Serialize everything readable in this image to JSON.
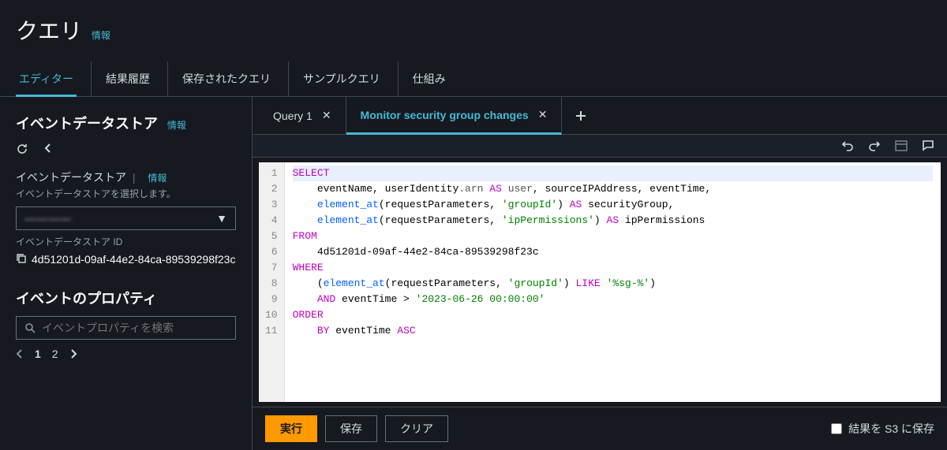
{
  "header": {
    "title": "クエリ",
    "info": "情報"
  },
  "tabs": [
    "エディター",
    "結果履歴",
    "保存されたクエリ",
    "サンプルクエリ",
    "仕組み"
  ],
  "active_tab": 0,
  "sidebar": {
    "datastore": {
      "title": "イベントデータストア",
      "info": "情報",
      "label": "イベントデータストア",
      "label_info": "情報",
      "hint": "イベントデータストアを選択します。",
      "selected": "————",
      "id_label": "イベントデータストア ID",
      "id_value": "4d51201d-09af-44e2-84ca-89539298f23c"
    },
    "properties": {
      "title": "イベントのプロパティ",
      "search_placeholder": "イベントプロパティを検索",
      "pages": [
        "1",
        "2"
      ]
    }
  },
  "file_tabs": [
    {
      "label": "Query 1",
      "active": false
    },
    {
      "label": "Monitor security group changes",
      "active": true
    }
  ],
  "code": {
    "lines": [
      [
        [
          "kw",
          "SELECT"
        ]
      ],
      [
        [
          "txt",
          "    eventName, userIdentity"
        ],
        [
          "ident",
          ".arn"
        ],
        [
          "txt",
          " "
        ],
        [
          "kw",
          "AS"
        ],
        [
          "txt",
          " "
        ],
        [
          "ident",
          "user"
        ],
        [
          "txt",
          ", sourceIPAddress, eventTime,"
        ]
      ],
      [
        [
          "txt",
          "    "
        ],
        [
          "fn",
          "element_at"
        ],
        [
          "txt",
          "(requestParameters, "
        ],
        [
          "str",
          "'groupId'"
        ],
        [
          "txt",
          ") "
        ],
        [
          "kw",
          "AS"
        ],
        [
          "txt",
          " securityGroup,"
        ]
      ],
      [
        [
          "txt",
          "    "
        ],
        [
          "fn",
          "element_at"
        ],
        [
          "txt",
          "(requestParameters, "
        ],
        [
          "str",
          "'ipPermissions'"
        ],
        [
          "txt",
          ") "
        ],
        [
          "kw",
          "AS"
        ],
        [
          "txt",
          " ipPermissions"
        ]
      ],
      [
        [
          "kw",
          "FROM"
        ]
      ],
      [
        [
          "txt",
          "    4d51201d-09af-44e2-84ca-89539298f23c"
        ]
      ],
      [
        [
          "kw",
          "WHERE"
        ]
      ],
      [
        [
          "txt",
          "    ("
        ],
        [
          "fn",
          "element_at"
        ],
        [
          "txt",
          "(requestParameters, "
        ],
        [
          "str",
          "'groupId'"
        ],
        [
          "txt",
          ") "
        ],
        [
          "kw",
          "LIKE"
        ],
        [
          "txt",
          " "
        ],
        [
          "str",
          "'%sg-%'"
        ],
        [
          "txt",
          ")"
        ]
      ],
      [
        [
          "txt",
          "    "
        ],
        [
          "kw",
          "AND"
        ],
        [
          "txt",
          " eventTime > "
        ],
        [
          "str",
          "'2023-06-26 00:00:00'"
        ]
      ],
      [
        [
          "kw",
          "ORDER"
        ]
      ],
      [
        [
          "txt",
          "    "
        ],
        [
          "kw",
          "BY"
        ],
        [
          "txt",
          " eventTime "
        ],
        [
          "kw",
          "ASC"
        ]
      ]
    ]
  },
  "footer": {
    "run": "実行",
    "save": "保存",
    "clear": "クリア",
    "save_s3": "結果を S3 に保存"
  }
}
